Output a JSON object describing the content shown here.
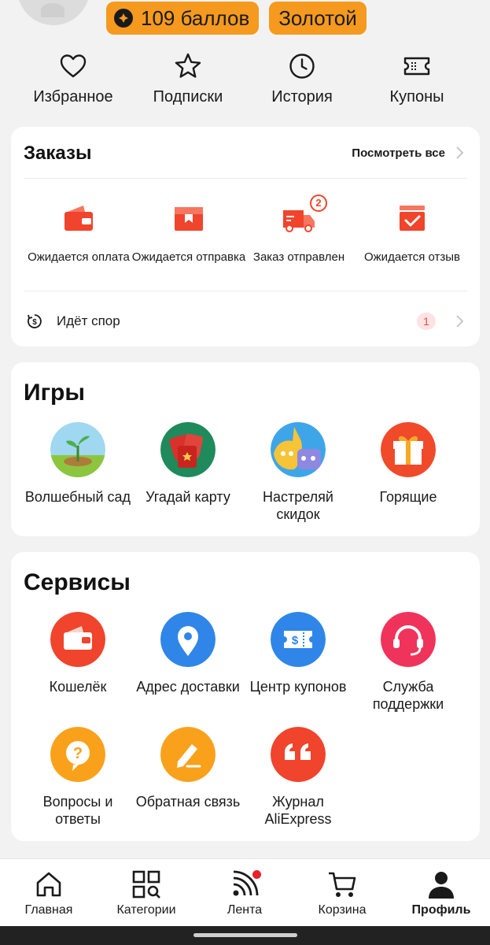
{
  "header": {
    "points_label": "109 баллов",
    "level_label": "Золотой"
  },
  "quick_links": [
    {
      "label": "Избранное",
      "icon": "heart-icon"
    },
    {
      "label": "Подписки",
      "icon": "star-icon"
    },
    {
      "label": "История",
      "icon": "clock-icon"
    },
    {
      "label": "Купоны",
      "icon": "ticket-icon"
    }
  ],
  "orders": {
    "title": "Заказы",
    "see_all": "Посмотреть все",
    "items": [
      {
        "label": "Ожидается оплата",
        "icon": "wallet-icon"
      },
      {
        "label": "Ожидается отправка",
        "icon": "box-icon"
      },
      {
        "label": "Заказ отправлен",
        "icon": "truck-icon",
        "badge": "2"
      },
      {
        "label": "Ожидается отзыв",
        "icon": "review-icon"
      }
    ],
    "dispute": {
      "label": "Идёт спор",
      "count": "1"
    }
  },
  "games": {
    "title": "Игры",
    "items": [
      {
        "label": "Волшебный сад",
        "icon": "sprout-icon"
      },
      {
        "label": "Угадай карту",
        "icon": "cards-icon"
      },
      {
        "label": "Настреляй скидок",
        "icon": "shooter-icon"
      },
      {
        "label": "Горящие",
        "icon": "gift-icon"
      }
    ]
  },
  "services": {
    "title": "Сервисы",
    "items": [
      {
        "label": "Кошелёк",
        "icon": "wallet-icon"
      },
      {
        "label": "Адрес доставки",
        "icon": "location-pin-icon"
      },
      {
        "label": "Центр купонов",
        "icon": "coupon-icon"
      },
      {
        "label": "Служба поддержки",
        "icon": "headset-icon"
      },
      {
        "label": "Вопросы и ответы",
        "icon": "question-icon"
      },
      {
        "label": "Обратная связь",
        "icon": "pen-icon"
      },
      {
        "label": "Журнал AliExpress",
        "icon": "quote-icon"
      }
    ]
  },
  "bottom_nav": [
    {
      "label": "Главная",
      "icon": "home-icon"
    },
    {
      "label": "Категории",
      "icon": "categories-icon"
    },
    {
      "label": "Лента",
      "icon": "feed-icon"
    },
    {
      "label": "Корзина",
      "icon": "cart-icon"
    },
    {
      "label": "Профиль",
      "icon": "profile-icon",
      "active": true
    }
  ],
  "colors": {
    "accent": "#f59a1e",
    "order_icon": "#f0442c",
    "background": "#f2f2f2"
  }
}
